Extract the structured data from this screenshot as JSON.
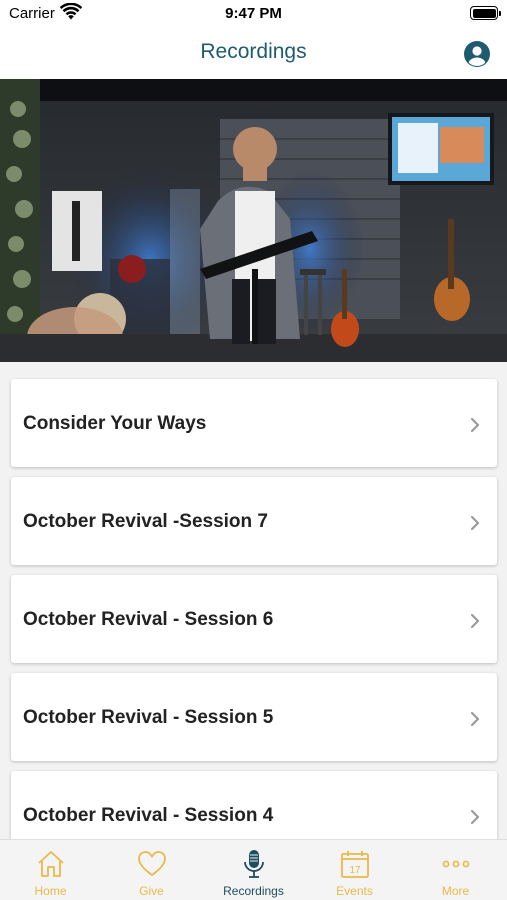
{
  "status_bar": {
    "carrier": "Carrier",
    "time": "9:47 PM"
  },
  "header": {
    "title": "Recordings",
    "profile_icon": "person-circle-icon"
  },
  "hero": {
    "icon": "sermon-photo"
  },
  "recordings": [
    {
      "title": "Consider Your Ways"
    },
    {
      "title": "October Revival -Session 7"
    },
    {
      "title": "October Revival - Session 6"
    },
    {
      "title": "October Revival - Session 5"
    },
    {
      "title": "October Revival - Session 4"
    }
  ],
  "tab_bar": {
    "tabs": [
      {
        "label": "Home",
        "icon": "home-icon"
      },
      {
        "label": "Give",
        "icon": "heart-icon"
      },
      {
        "label": "Recordings",
        "icon": "microphone-icon",
        "active": true
      },
      {
        "label": "Events",
        "icon": "calendar-icon",
        "date": "17"
      },
      {
        "label": "More",
        "icon": "more-dots-icon"
      }
    ]
  },
  "colors": {
    "accent": "#1e5b6e",
    "tab_inactive": "#e9b949",
    "tab_active": "#1e4d5e"
  }
}
